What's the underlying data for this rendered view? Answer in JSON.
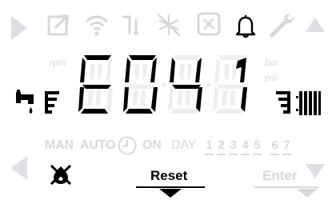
{
  "display": {
    "code_digits": [
      "E",
      "0",
      "4",
      "1"
    ],
    "units": {
      "rpm": "rpm",
      "bar": "bar",
      "psi": "psi"
    },
    "modes": {
      "man": "MAN",
      "auto": "AUTO",
      "on": "ON",
      "day": "DAY"
    },
    "days": [
      "1",
      "2",
      "3",
      "4",
      "5",
      "6",
      "7"
    ],
    "buttons": {
      "reset": "Reset",
      "enter": "Enter"
    }
  },
  "colors": {
    "active": "#000000",
    "inactive": "#d6d8db"
  },
  "icons": {
    "top_row": [
      "play-right-icon",
      "external-link-icon",
      "wifi-icon",
      "sensor-icon",
      "antifreeze-icon",
      "fan-icon",
      "bell-icon",
      "wrench-icon",
      "arrow-up-icon"
    ],
    "active": [
      "bell-icon",
      "tap-icon",
      "radiator-icon",
      "flame-off-icon"
    ]
  }
}
